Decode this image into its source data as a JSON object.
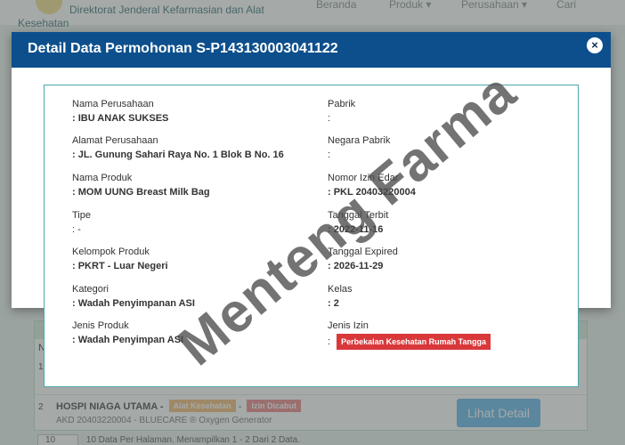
{
  "background": {
    "brand": "Direktorat Jenderal Kefarmasian dan Alat",
    "brand_line2": "Kesehatan",
    "nav": [
      "Beranda",
      "Produk ▾",
      "Perusahaan ▾",
      "Cari"
    ],
    "table": {
      "col_no": "N",
      "row1_num": "1",
      "row2": {
        "num": "2",
        "company": "HOSPI NIAGA UTAMA -",
        "badge1": "Alat Kesehatan",
        "sep": "-",
        "badge2": "Izin Dicabut",
        "sub": "AKD 20403220004 - BLUECARE ® Oxygen Generator",
        "button": "Lihat Detail"
      }
    },
    "footer": {
      "per_page": "10",
      "text": "10 Data Per Halaman. Menampilkan 1 - 2 Dari 2 Data."
    }
  },
  "modal": {
    "title": "Detail Data Permohonan S-P143130003041122",
    "close": "×"
  },
  "detail": {
    "left": [
      {
        "label": "Nama Perusahaan",
        "value": ": IBU ANAK SUKSES"
      },
      {
        "label": "Alamat Perusahaan",
        "value": ": JL. Gunung Sahari Raya No. 1 Blok B No. 16"
      },
      {
        "label": "Nama Produk",
        "value": ": MOM UUNG Breast Milk Bag"
      },
      {
        "label": "Tipe",
        "value": ": -"
      },
      {
        "label": "Kelompok Produk",
        "value": ": PKRT - Luar Negeri"
      },
      {
        "label": "Kategori",
        "value": ": Wadah Penyimpanan ASI"
      },
      {
        "label": "Jenis Produk",
        "value": ": Wadah Penyimpan ASI"
      }
    ],
    "right": [
      {
        "label": "Pabrik",
        "value": ":"
      },
      {
        "label": "Negara Pabrik",
        "value": ":"
      },
      {
        "label": "Nomor Izin Edar",
        "value": ": PKL 20403220004"
      },
      {
        "label": "Tanggal Terbit",
        "value": ": 2022-11-16"
      },
      {
        "label": "Tanggal Expired",
        "value": ": 2026-11-29"
      },
      {
        "label": "Kelas",
        "value": ": 2"
      },
      {
        "label": "Jenis Izin",
        "value": ":",
        "badge": "Perbekalan Kesehatan Rumah Tangga"
      }
    ]
  },
  "watermark": "Menteng Farma",
  "colors": {
    "header": "#0d4f8c",
    "box_border": "#4da7a9",
    "izin_badge": "#d9383b",
    "detail_button": "#7fc3ee"
  }
}
